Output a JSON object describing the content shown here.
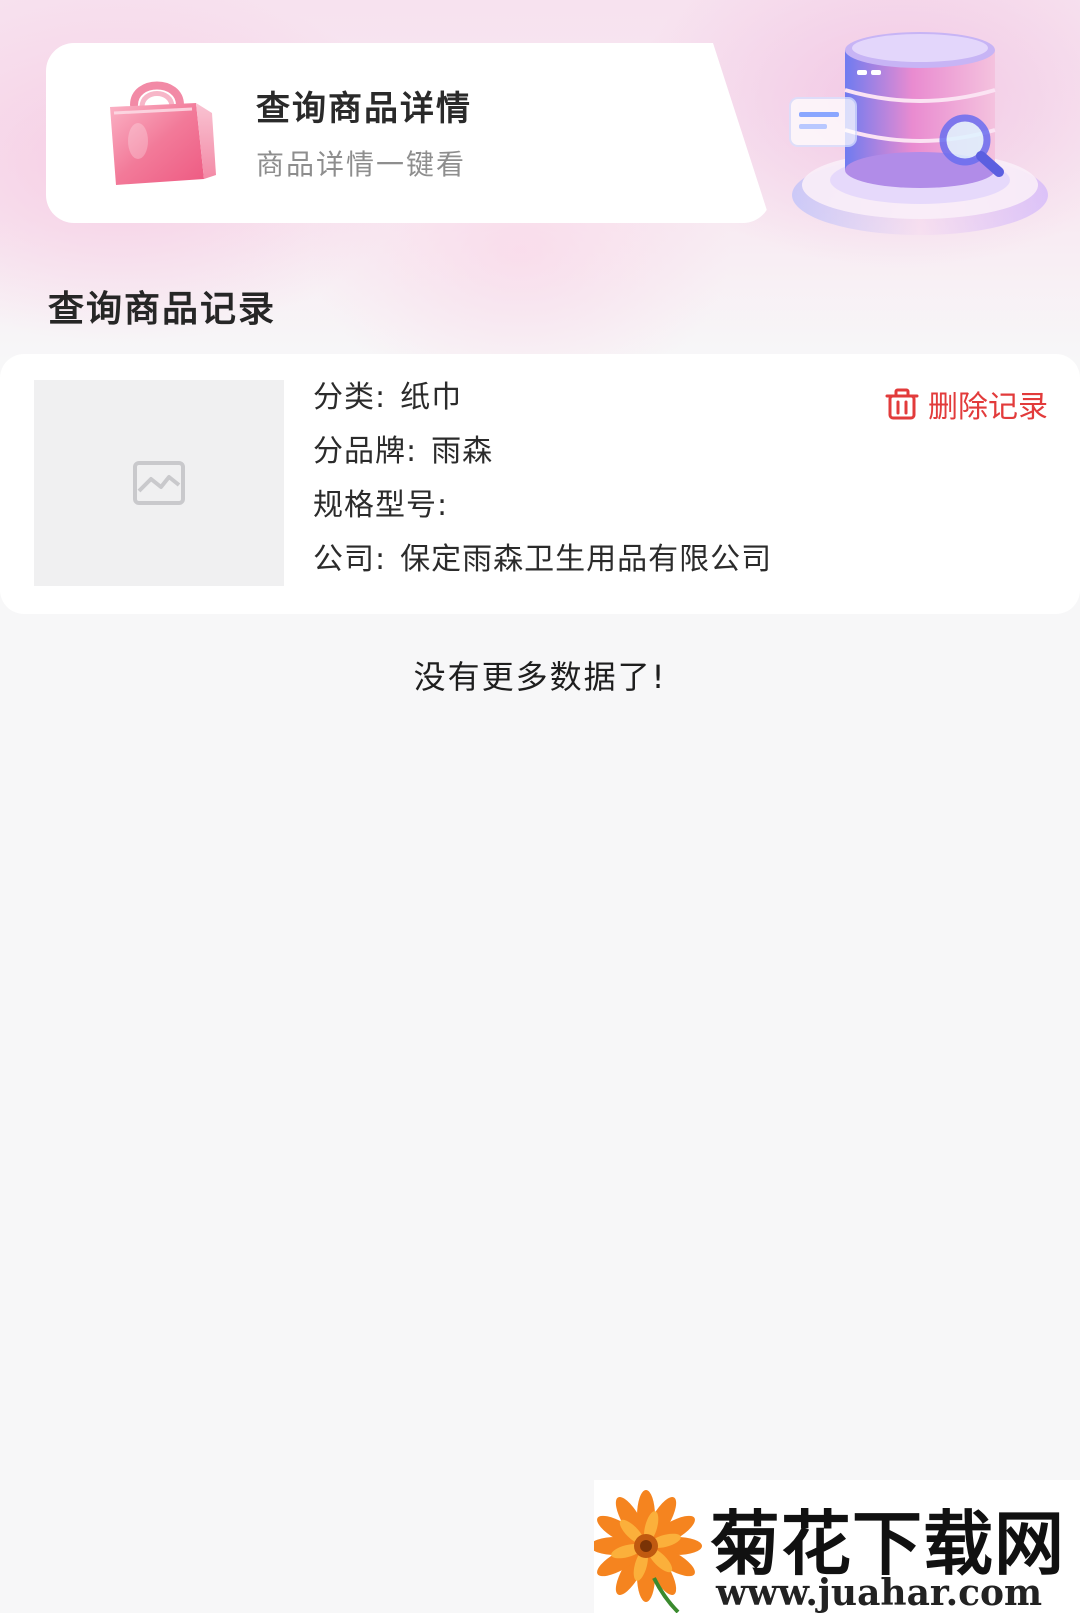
{
  "header": {
    "card_title": "查询商品详情",
    "card_subtitle": "商品详情一键看"
  },
  "section": {
    "title": "查询商品记录"
  },
  "record": {
    "category_label": "分类:",
    "category_value": "纸巾",
    "brand_label": "分品牌:",
    "brand_value": "雨森",
    "spec_label": "规格型号:",
    "spec_value": "",
    "company_label": "公司:",
    "company_value": "保定雨森卫生用品有限公司",
    "delete_label": "删除记录",
    "thumbnail_icon": "image-placeholder-icon"
  },
  "list": {
    "end_text": "没有更多数据了!"
  },
  "watermark": {
    "title": "菊花下载网",
    "url": "www.juahar.com"
  },
  "colors": {
    "accent_red": "#e23b3b",
    "bag_pink": "#f06a8f",
    "background": "#f7f7f8"
  }
}
